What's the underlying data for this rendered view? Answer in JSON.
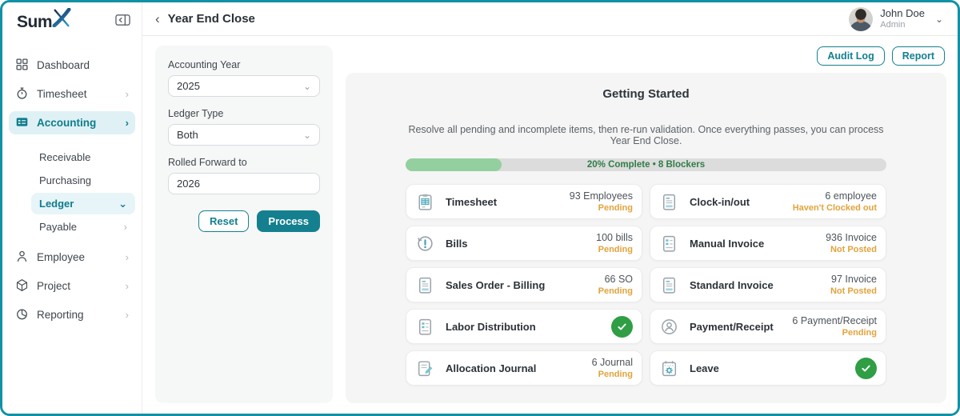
{
  "app": {
    "logo_text": "Sum",
    "colors": {
      "accent": "#14808F",
      "frame_border": "#1291A4",
      "success": "#2F9E44",
      "warning": "#E2A33C",
      "progress_fill": "#94CF9F",
      "progress_text": "#2E7D46",
      "active_item_bg": "#DFF1F4"
    }
  },
  "header": {
    "title": "Year End Close",
    "back_icon": "chevron-left-icon",
    "user": {
      "name": "John Doe",
      "role": "Admin"
    }
  },
  "sidebar": {
    "items": [
      {
        "label": "Dashboard",
        "icon": "dashboard-grid-icon",
        "active": false
      },
      {
        "label": "Timesheet",
        "icon": "stopwatch-icon",
        "expandable": true,
        "active": false
      },
      {
        "label": "Accounting",
        "icon": "ledger-card-icon",
        "expandable": true,
        "active": true
      },
      {
        "label": "Receivable",
        "sub": true,
        "active": false
      },
      {
        "label": "Purchasing",
        "sub": true,
        "active": false
      },
      {
        "label": "Ledger",
        "sub": true,
        "active": true,
        "expanded": true
      },
      {
        "label": "Payable",
        "sub": true,
        "expandable": true,
        "active": false
      },
      {
        "label": "Employee",
        "icon": "person-icon",
        "expandable": true,
        "active": false
      },
      {
        "label": "Project",
        "icon": "cube-icon",
        "expandable": true,
        "active": false
      },
      {
        "label": "Reporting",
        "icon": "pie-chart-icon",
        "expandable": true,
        "active": false
      }
    ]
  },
  "form": {
    "accounting_year": {
      "label": "Accounting Year",
      "value": "2025"
    },
    "ledger_type": {
      "label": "Ledger Type",
      "value": "Both"
    },
    "rolled_forward": {
      "label": "Rolled Forward to",
      "value": "2026"
    },
    "reset_label": "Reset",
    "process_label": "Process"
  },
  "actions": {
    "audit_log": "Audit Log",
    "report": "Report"
  },
  "board": {
    "title": "Getting Started",
    "description": "Resolve all pending and incomplete items, then re-run validation. Once everything passes, you can process Year End Close.",
    "progress": {
      "percent": 20,
      "label": "20% Complete • 8 Blockers"
    },
    "cards": [
      {
        "title": "Timesheet",
        "icon": "clipboard-table-icon",
        "value": "93 Employees",
        "status": "Pending",
        "done": false
      },
      {
        "title": "Clock-in/out",
        "icon": "document-icon",
        "value": "6 employee",
        "status": "Haven't Clocked out",
        "done": false
      },
      {
        "title": "Bills",
        "icon": "history-circle-icon",
        "value": "100 bills",
        "status": "Pending",
        "done": false
      },
      {
        "title": "Manual Invoice",
        "icon": "invoice-list-icon",
        "value": "936 Invoice",
        "status": "Not Posted",
        "done": false
      },
      {
        "title": "Sales Order - Billing",
        "icon": "document-icon",
        "value": "66 SO",
        "status": "Pending",
        "done": false
      },
      {
        "title": "Standard Invoice",
        "icon": "document-icon",
        "value": "97 Invoice",
        "status": "Not Posted",
        "done": false
      },
      {
        "title": "Labor Distribution",
        "icon": "invoice-list-icon",
        "done": true
      },
      {
        "title": "Payment/Receipt",
        "icon": "person-circle-icon",
        "value": "6 Payment/Receipt",
        "status": "Pending",
        "done": false
      },
      {
        "title": "Allocation Journal",
        "icon": "document-pencil-icon",
        "value": "6 Journal",
        "status": "Pending",
        "done": false
      },
      {
        "title": "Leave",
        "icon": "calendar-sun-icon",
        "done": true
      }
    ]
  }
}
